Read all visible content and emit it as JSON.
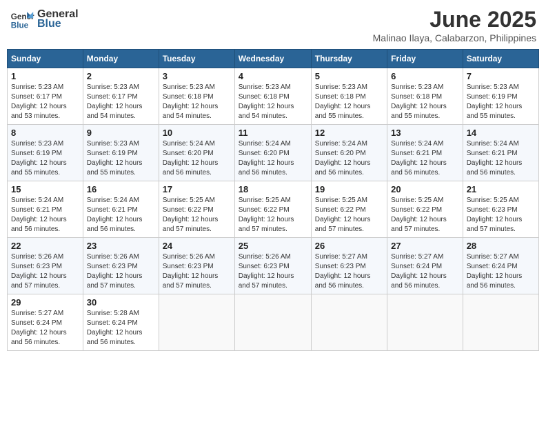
{
  "logo": {
    "line1": "General",
    "line2": "Blue"
  },
  "title": "June 2025",
  "subtitle": "Malinao Ilaya, Calabarzon, Philippines",
  "weekdays": [
    "Sunday",
    "Monday",
    "Tuesday",
    "Wednesday",
    "Thursday",
    "Friday",
    "Saturday"
  ],
  "weeks": [
    [
      {
        "day": "1",
        "sunrise": "5:23 AM",
        "sunset": "6:17 PM",
        "daylight": "12 hours and 53 minutes."
      },
      {
        "day": "2",
        "sunrise": "5:23 AM",
        "sunset": "6:17 PM",
        "daylight": "12 hours and 54 minutes."
      },
      {
        "day": "3",
        "sunrise": "5:23 AM",
        "sunset": "6:18 PM",
        "daylight": "12 hours and 54 minutes."
      },
      {
        "day": "4",
        "sunrise": "5:23 AM",
        "sunset": "6:18 PM",
        "daylight": "12 hours and 54 minutes."
      },
      {
        "day": "5",
        "sunrise": "5:23 AM",
        "sunset": "6:18 PM",
        "daylight": "12 hours and 55 minutes."
      },
      {
        "day": "6",
        "sunrise": "5:23 AM",
        "sunset": "6:18 PM",
        "daylight": "12 hours and 55 minutes."
      },
      {
        "day": "7",
        "sunrise": "5:23 AM",
        "sunset": "6:19 PM",
        "daylight": "12 hours and 55 minutes."
      }
    ],
    [
      {
        "day": "8",
        "sunrise": "5:23 AM",
        "sunset": "6:19 PM",
        "daylight": "12 hours and 55 minutes."
      },
      {
        "day": "9",
        "sunrise": "5:23 AM",
        "sunset": "6:19 PM",
        "daylight": "12 hours and 55 minutes."
      },
      {
        "day": "10",
        "sunrise": "5:24 AM",
        "sunset": "6:20 PM",
        "daylight": "12 hours and 56 minutes."
      },
      {
        "day": "11",
        "sunrise": "5:24 AM",
        "sunset": "6:20 PM",
        "daylight": "12 hours and 56 minutes."
      },
      {
        "day": "12",
        "sunrise": "5:24 AM",
        "sunset": "6:20 PM",
        "daylight": "12 hours and 56 minutes."
      },
      {
        "day": "13",
        "sunrise": "5:24 AM",
        "sunset": "6:21 PM",
        "daylight": "12 hours and 56 minutes."
      },
      {
        "day": "14",
        "sunrise": "5:24 AM",
        "sunset": "6:21 PM",
        "daylight": "12 hours and 56 minutes."
      }
    ],
    [
      {
        "day": "15",
        "sunrise": "5:24 AM",
        "sunset": "6:21 PM",
        "daylight": "12 hours and 56 minutes."
      },
      {
        "day": "16",
        "sunrise": "5:24 AM",
        "sunset": "6:21 PM",
        "daylight": "12 hours and 56 minutes."
      },
      {
        "day": "17",
        "sunrise": "5:25 AM",
        "sunset": "6:22 PM",
        "daylight": "12 hours and 57 minutes."
      },
      {
        "day": "18",
        "sunrise": "5:25 AM",
        "sunset": "6:22 PM",
        "daylight": "12 hours and 57 minutes."
      },
      {
        "day": "19",
        "sunrise": "5:25 AM",
        "sunset": "6:22 PM",
        "daylight": "12 hours and 57 minutes."
      },
      {
        "day": "20",
        "sunrise": "5:25 AM",
        "sunset": "6:22 PM",
        "daylight": "12 hours and 57 minutes."
      },
      {
        "day": "21",
        "sunrise": "5:25 AM",
        "sunset": "6:23 PM",
        "daylight": "12 hours and 57 minutes."
      }
    ],
    [
      {
        "day": "22",
        "sunrise": "5:26 AM",
        "sunset": "6:23 PM",
        "daylight": "12 hours and 57 minutes."
      },
      {
        "day": "23",
        "sunrise": "5:26 AM",
        "sunset": "6:23 PM",
        "daylight": "12 hours and 57 minutes."
      },
      {
        "day": "24",
        "sunrise": "5:26 AM",
        "sunset": "6:23 PM",
        "daylight": "12 hours and 57 minutes."
      },
      {
        "day": "25",
        "sunrise": "5:26 AM",
        "sunset": "6:23 PM",
        "daylight": "12 hours and 57 minutes."
      },
      {
        "day": "26",
        "sunrise": "5:27 AM",
        "sunset": "6:23 PM",
        "daylight": "12 hours and 56 minutes."
      },
      {
        "day": "27",
        "sunrise": "5:27 AM",
        "sunset": "6:24 PM",
        "daylight": "12 hours and 56 minutes."
      },
      {
        "day": "28",
        "sunrise": "5:27 AM",
        "sunset": "6:24 PM",
        "daylight": "12 hours and 56 minutes."
      }
    ],
    [
      {
        "day": "29",
        "sunrise": "5:27 AM",
        "sunset": "6:24 PM",
        "daylight": "12 hours and 56 minutes."
      },
      {
        "day": "30",
        "sunrise": "5:28 AM",
        "sunset": "6:24 PM",
        "daylight": "12 hours and 56 minutes."
      },
      null,
      null,
      null,
      null,
      null
    ]
  ]
}
